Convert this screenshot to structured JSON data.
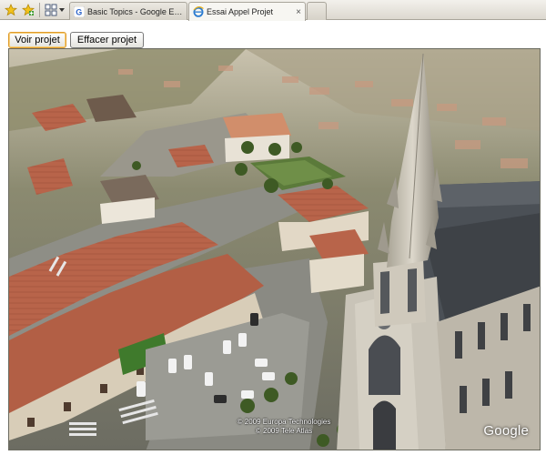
{
  "browser": {
    "tabs": [
      {
        "label": "Basic Topics - Google Earth A...",
        "active": false
      },
      {
        "label": "Essai Appel Projet",
        "active": true
      }
    ],
    "close_glyph": "×",
    "icons": [
      "favorites-star-icon",
      "add-favorite-icon",
      "quick-tabs-icon",
      "tab-list-dropdown-icon",
      "google-favicon",
      "ie-page-icon",
      "new-tab-icon"
    ]
  },
  "toolbar": {
    "view_button": "Voir projet",
    "clear_button": "Effacer projet"
  },
  "map": {
    "copyright_line1": "© 2009 Europa Technologies",
    "copyright_line2": "© 2009 Tele Atlas",
    "logo": "Google"
  },
  "colors": {
    "tab_bg": "#dcd8cf",
    "active_tab_bg": "#f7f6f2",
    "button_focus": "#e09b2a",
    "roof": "#b8644a",
    "road": "#8e8e86",
    "grass": "#5b7a3a",
    "church_stone": "#c9c4b8"
  }
}
